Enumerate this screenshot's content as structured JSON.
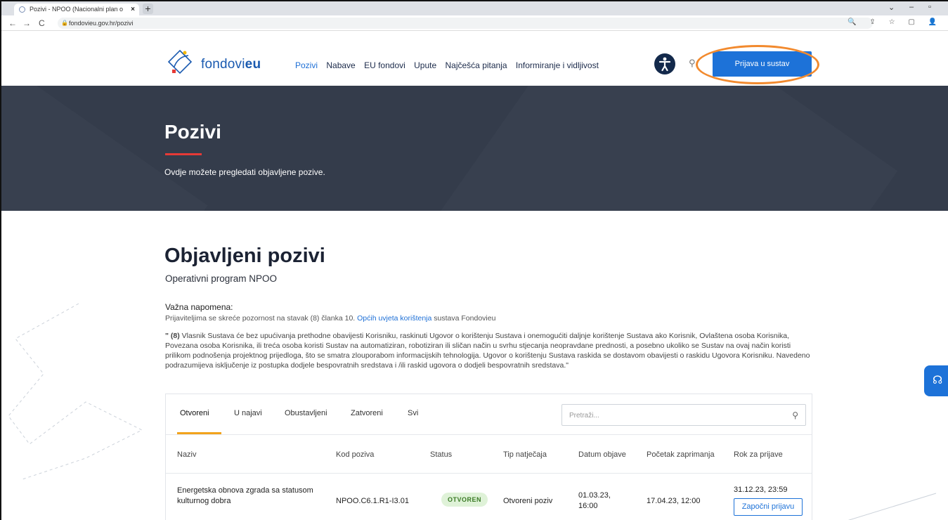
{
  "browser": {
    "tab_title": "Pozivi - NPOO (Nacionalni plan o",
    "tab_close": "×",
    "new_tab": "+",
    "url": "fondovieu.gov.hr/pozivi",
    "win_min": "–",
    "win_max": "▫",
    "win_chev": "⌄",
    "omni_icons": "🔍 ⇪ ☆ ▢ 👤"
  },
  "header": {
    "logo_text_plain": "fondovi",
    "logo_text_bold": "eu",
    "nav": [
      "Pozivi",
      "Nabave",
      "EU fondovi",
      "Upute",
      "Najčešća pitanja",
      "Informiranje i vidljivost"
    ],
    "a11y_glyph": "✦",
    "login_label": "Prijava u sustav"
  },
  "hero": {
    "title": "Pozivi",
    "subtitle": "Ovdje možete pregledati objavljene pozive."
  },
  "content": {
    "title": "Objavljeni pozivi",
    "subtitle": "Operativni program NPOO",
    "note_head": "Važna napomena:",
    "note_before": "Prijaviteljima se skreće pozornost na stavak (8) članka 10. ",
    "note_link": "Općih uvjeta korištenja",
    "note_after": " sustava Fondovieu",
    "quote_lead": "\" (8)",
    "quote_body": " Vlasnik Sustava će bez upućivanja prethodne obavijesti Korisniku, raskinuti Ugovor o korištenju Sustava i onemogućiti daljnje korištenje Sustava ako Korisnik, Ovlaštena osoba Korisnika, Povezana osoba Korisnika, ili treća osoba koristi Sustav na automatiziran, robotiziran ili sličan način u svrhu stjecanja neopravdane prednosti, a posebno ukoliko se Sustav na ovaj način koristi prilikom podnošenja projektnog prijedloga, što se smatra zlouporabom informacijskih tehnologija. Ugovor o korištenju Sustava raskida se dostavom obavijesti o raskidu Ugovora Korisniku. Navedeno podrazumijeva isključenje iz postupka dodjele bespovratnih sredstava i /ili raskid ugovora o dodjeli bespovratnih sredstava.\""
  },
  "filters": {
    "tabs": [
      "Otvoreni",
      "U najavi",
      "Obustavljeni",
      "Zatvoreni",
      "Svi"
    ],
    "active": "Otvoreni",
    "search_placeholder": "Pretraži..."
  },
  "table": {
    "headers": [
      "Naziv",
      "Kod poziva",
      "Status",
      "Tip natječaja",
      "Datum objave",
      "Početak zaprimanja",
      "Rok za prijave"
    ],
    "rows": [
      {
        "naziv": "Energetska obnova zgrada sa statusom kulturnog dobra",
        "kod": "NPOO.C6.1.R1-I3.01",
        "status": "OTVOREN",
        "tip": "Otvoreni poziv",
        "datum": "01.03.23, 16:00",
        "pocetak": "17.04.23, 12:00",
        "rok": "31.12.23, 23:59",
        "action": "Započni prijavu"
      }
    ]
  },
  "colors": {
    "accent": "#1d72d8",
    "hero_bg": "#343c4b",
    "highlight_ring": "#f28a2e",
    "status_bg": "#dff2d8",
    "tab_underline": "#f2a31c"
  },
  "icons": {
    "search": "search-icon",
    "accessibility": "accessibility-icon",
    "help": "headset-icon"
  }
}
